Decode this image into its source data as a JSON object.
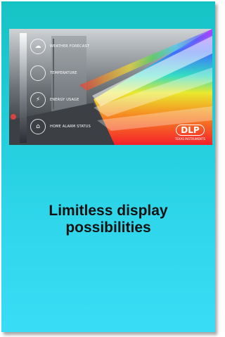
{
  "photo": {
    "hud_items": [
      {
        "icon": "cloud-sun-icon",
        "glyph": "☁",
        "label": "WEATHER FORECAST"
      },
      {
        "icon": "thermometer-icon",
        "glyph": "",
        "label": "TEMPERATURE"
      },
      {
        "icon": "lightning-icon",
        "glyph": "⚡",
        "label": "ENERGY USAGE"
      },
      {
        "icon": "home-icon",
        "glyph": "⌂",
        "label": "HOME ALARM STATUS"
      }
    ],
    "logo_text": "DLP",
    "logo_sub": "TEXAS INSTRUMENTS"
  },
  "headline": {
    "line1": "Limitless display",
    "line2": "possibilities"
  },
  "colors": {
    "card_top": "#16c3c4",
    "card_bottom": "#39dcf5",
    "text": "#111111"
  }
}
